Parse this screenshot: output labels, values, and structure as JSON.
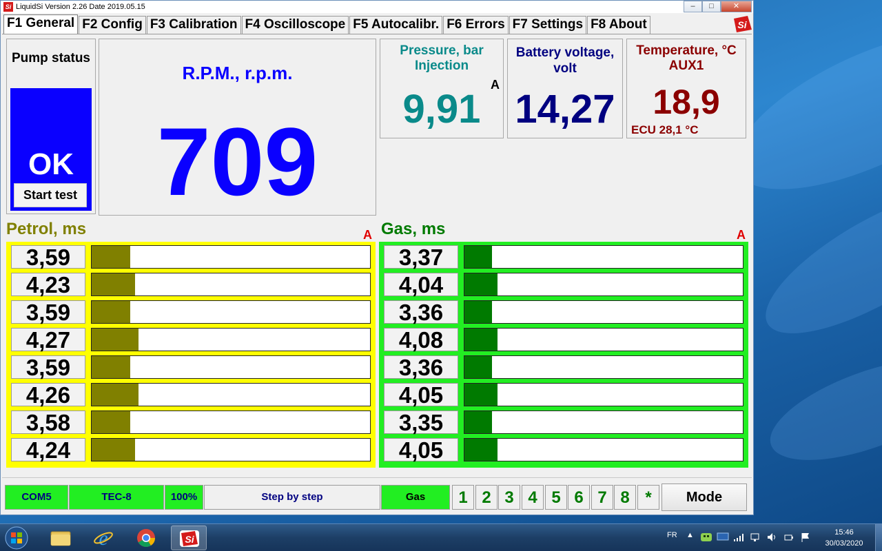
{
  "window": {
    "title": "LiquidSi  Version 2.26  Date 2019.05.15",
    "logo_text": "Si",
    "minimize": "–",
    "maximize": "□",
    "close": "✕"
  },
  "tabs": [
    {
      "label": "F1 General",
      "active": true
    },
    {
      "label": "F2 Config"
    },
    {
      "label": "F3 Calibration"
    },
    {
      "label": "F4 Oscilloscope"
    },
    {
      "label": "F5 Autocalibr."
    },
    {
      "label": "F6 Errors"
    },
    {
      "label": "F7 Settings"
    },
    {
      "label": "F8 About"
    }
  ],
  "pump": {
    "title": "Pump status",
    "status": "OK",
    "status_color": "#0a00ff",
    "test_button": "Start test"
  },
  "rpm": {
    "title": "R.P.M.,  r.p.m.",
    "value": "709",
    "color": "#0a00ff"
  },
  "pressure": {
    "title_line1": "Pressure,  bar",
    "title_line2": "Injection",
    "flag": "A",
    "value": "9,91",
    "color": "#0a8a8a"
  },
  "battery": {
    "title_line1": "Battery voltage,",
    "title_line2": "volt",
    "value": "14,27",
    "color": "#000080"
  },
  "temperature": {
    "title_line1": "Temperature, °C",
    "title_line2": "AUX1",
    "value": "18,9",
    "ecu": "ECU 28,1 °C",
    "color": "#8b0000"
  },
  "petrol": {
    "title": "Petrol,  ms",
    "flag": "A",
    "color": "#808000",
    "frame_color": "#ffff00",
    "rows": [
      {
        "value": "3,59",
        "level": 0.138
      },
      {
        "value": "4,23",
        "level": 0.155
      },
      {
        "value": "3,59",
        "level": 0.138
      },
      {
        "value": "4,27",
        "level": 0.168
      },
      {
        "value": "3,59",
        "level": 0.138
      },
      {
        "value": "4,26",
        "level": 0.168
      },
      {
        "value": "3,58",
        "level": 0.138
      },
      {
        "value": "4,24",
        "level": 0.155
      }
    ]
  },
  "gas": {
    "title": "Gas,  ms",
    "flag": "A",
    "color": "#007a00",
    "frame_color": "#22ee22",
    "rows": [
      {
        "value": "3,37",
        "level": 0.098
      },
      {
        "value": "4,04",
        "level": 0.118
      },
      {
        "value": "3,36",
        "level": 0.098
      },
      {
        "value": "4,08",
        "level": 0.118
      },
      {
        "value": "3,36",
        "level": 0.098
      },
      {
        "value": "4,05",
        "level": 0.118
      },
      {
        "value": "3,35",
        "level": 0.098
      },
      {
        "value": "4,05",
        "level": 0.118
      }
    ]
  },
  "statusbar": {
    "port": "COM5",
    "device": "TEC-8",
    "percent": "100%",
    "mode_text": "Step by step",
    "fuel": "Gas",
    "cylinders": [
      "1",
      "2",
      "3",
      "4",
      "5",
      "6",
      "7",
      "8",
      "*"
    ],
    "mode_button": "Mode"
  },
  "taskbar": {
    "language": "FR",
    "time": "15:46",
    "date": "30/03/2020",
    "apps": [
      {
        "icon": "file-explorer-icon"
      },
      {
        "icon": "internet-explorer-icon"
      },
      {
        "icon": "chrome-icon"
      },
      {
        "icon": "liquidsi-icon",
        "active": true
      }
    ]
  }
}
